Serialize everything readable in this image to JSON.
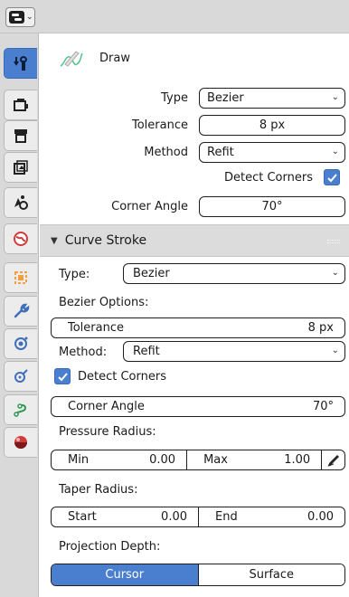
{
  "colors": {
    "accent": "#4a7fd0",
    "panel_bg": "#ffffff",
    "header_bg": "#d9d9d9"
  },
  "header": {
    "editor_icon": "editor-type-icon",
    "chevron": "⌄"
  },
  "tabs": [
    {
      "name": "tool-icon",
      "active": true
    },
    {
      "name": "render-icon",
      "active": false
    },
    {
      "name": "output-icon",
      "active": false
    },
    {
      "name": "view-layer-icon",
      "active": false
    },
    {
      "name": "scene-icon",
      "active": false
    },
    {
      "name": "world-icon",
      "active": false
    },
    {
      "name": "object-icon",
      "active": false
    },
    {
      "name": "modifier-icon",
      "active": false
    },
    {
      "name": "particles-icon",
      "active": false
    },
    {
      "name": "physics-icon",
      "active": false
    },
    {
      "name": "constraint-icon",
      "active": false
    },
    {
      "name": "material-icon",
      "active": false
    }
  ],
  "tool": {
    "name": "Draw",
    "type_label": "Type",
    "type_value": "Bezier",
    "tolerance_label": "Tolerance",
    "tolerance_value": "8 px",
    "method_label": "Method",
    "method_value": "Refit",
    "detect_corners_label": "Detect Corners",
    "detect_corners_checked": true,
    "corner_angle_label": "Corner Angle",
    "corner_angle_value": "70°"
  },
  "curve_stroke": {
    "title": "Curve Stroke",
    "type_label": "Type:",
    "type_value": "Bezier",
    "bezier_options_label": "Bezier Options:",
    "tolerance_label": "Tolerance",
    "tolerance_value": "8 px",
    "method_label": "Method:",
    "method_value": "Refit",
    "detect_corners_label": "Detect Corners",
    "detect_corners_checked": true,
    "corner_angle_label": "Corner Angle",
    "corner_angle_value": "70°",
    "pressure_radius_label": "Pressure Radius:",
    "pressure_min_label": "Min",
    "pressure_min_value": "0.00",
    "pressure_max_label": "Max",
    "pressure_max_value": "1.00",
    "taper_radius_label": "Taper Radius:",
    "taper_start_label": "Start",
    "taper_start_value": "0.00",
    "taper_end_label": "End",
    "taper_end_value": "0.00",
    "projection_depth_label": "Projection Depth:",
    "projection_options": [
      "Cursor",
      "Surface"
    ],
    "projection_selected": "Cursor"
  }
}
